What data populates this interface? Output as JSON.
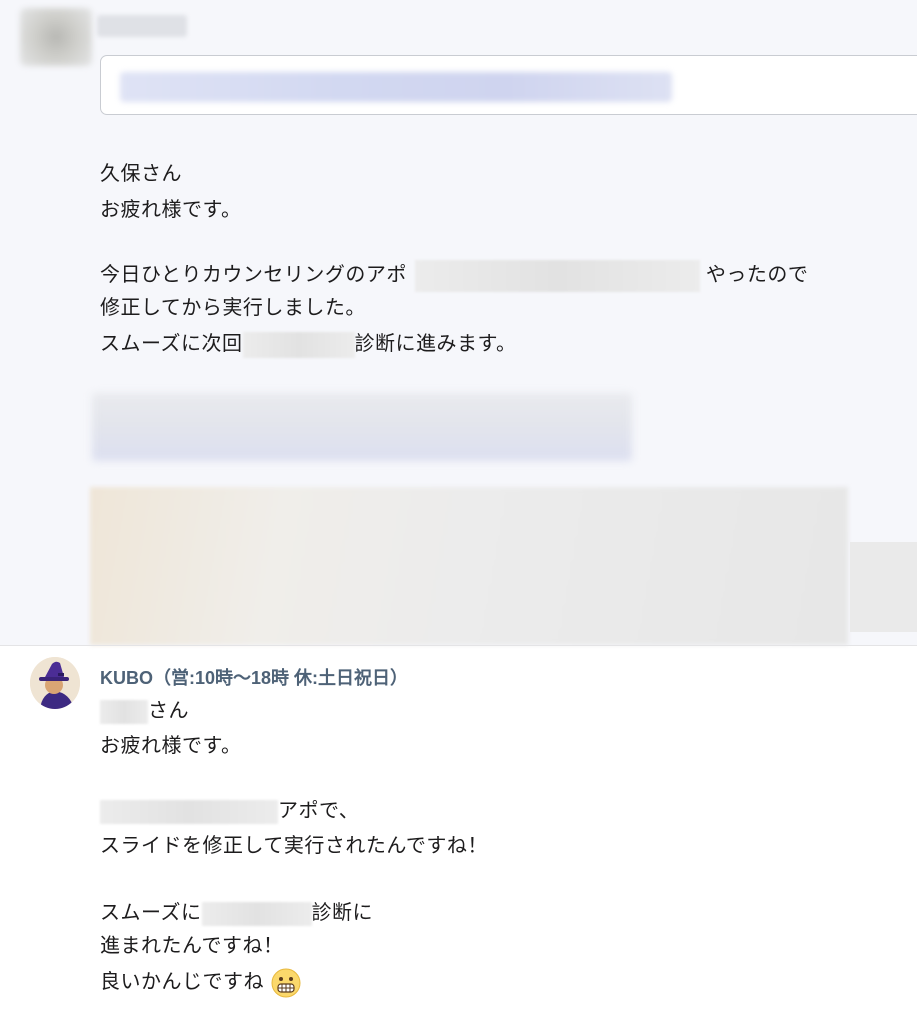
{
  "message1": {
    "greeting": "久保さん",
    "line2": "お疲れ様です。",
    "line3_pre": "今日ひとりカウンセリングのアポ",
    "line3_post": "やったので",
    "line4": "修正してから実行しました。",
    "line5_pre": "スムーズに次回",
    "line5_post": "診断に進みます。"
  },
  "message2": {
    "sender": "KUBO（営:10時〜18時 休:土日祝日）",
    "line1_post": "さん",
    "line2": "お疲れ様です。",
    "line3_post": "アポで、",
    "line4": "スライドを修正して実行されたんですね！",
    "line5_pre": "スムーズに",
    "line5_post": "診断に",
    "line6": "進まれたんですね！",
    "line7": "良いかんじですね",
    "emoji": "grimacing-face-icon"
  }
}
